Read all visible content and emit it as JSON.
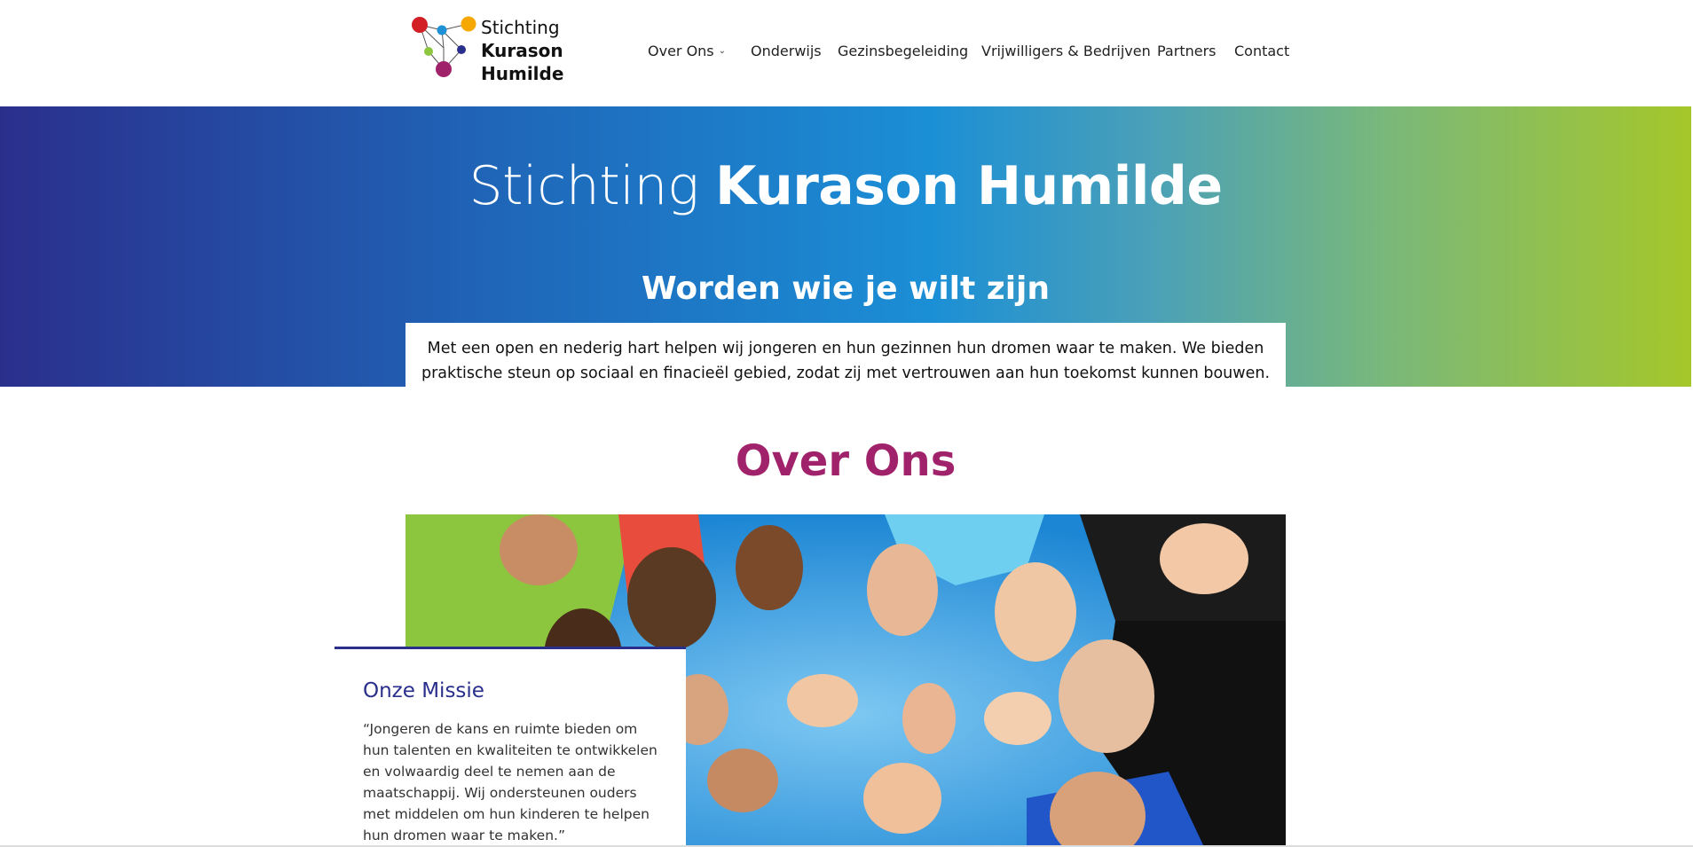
{
  "header": {
    "logo": {
      "line1": "Stichting",
      "line2": "Kurason",
      "line3": "Humilde",
      "dot_colors": [
        "#d21f26",
        "#1e90d6",
        "#f6a800",
        "#8dc63f",
        "#2a2f8c",
        "#a0226b"
      ]
    },
    "nav": [
      {
        "label": "Over Ons",
        "has_dropdown": true
      },
      {
        "label": "Onderwijs"
      },
      {
        "label": "Gezinsbegeleiding"
      },
      {
        "label": "Vrijwilligers & Bedrijven"
      },
      {
        "label": "Partners"
      },
      {
        "label": "Contact"
      }
    ]
  },
  "hero": {
    "title_light": "Stichting",
    "title_bold": "Kurason Humilde",
    "subtitle": "Worden wie je wilt zijn",
    "intro_line1": "Met een open en nederig hart helpen wij jongeren en hun gezinnen hun dromen waar te maken. We bieden",
    "intro_line2": "praktische steun op sociaal en finacieël gebied, zodat zij met vertrouwen aan hun toekomst kunnen bouwen.",
    "gradient_colors": [
      "#2a2f8c",
      "#1b8fd6",
      "#a5c72a"
    ]
  },
  "about": {
    "title": "Over Ons",
    "mission": {
      "heading": "Onze Missie",
      "text": "“Jongeren de kans en ruimte bieden om hun talenten en kwaliteiten te ontwikkelen en volwaardig deel te nemen aan de maatschappij. Wij ondersteunen ouders met middelen om hun kinderen te helpen hun dromen waar te maken.”"
    }
  },
  "colors": {
    "accent_magenta": "#a0226b",
    "accent_navy": "#2a2f8c"
  }
}
